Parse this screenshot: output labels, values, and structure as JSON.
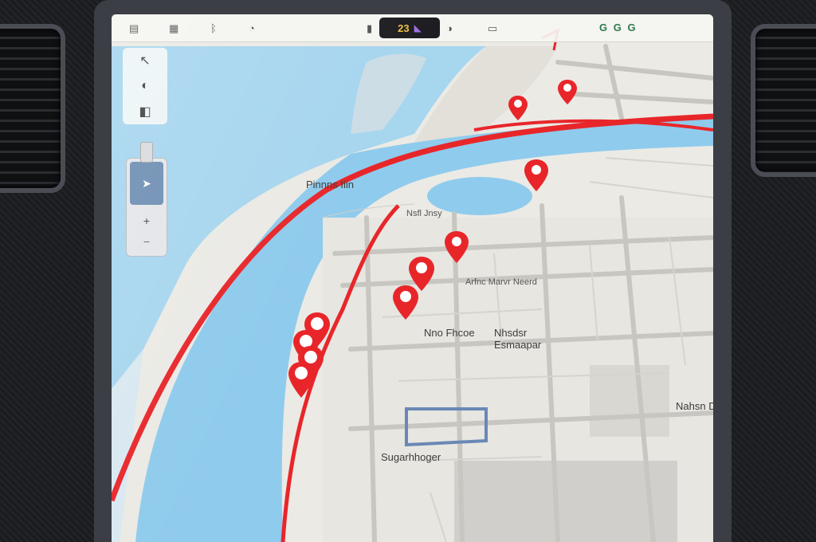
{
  "status_bar": {
    "left_icons": [
      "menu-icon",
      "grid-icon",
      "bluetooth-icon",
      "wifi-icon",
      "cellular-icon",
      "lock-icon"
    ],
    "temperature": "23",
    "temperature_icon": "wiper-icon",
    "right_text": "G G G"
  },
  "controls": {
    "top_buttons": [
      "compass-icon",
      "volume-icon",
      "layers-icon"
    ],
    "zoom_icon": "navigation-arrow-icon",
    "zoom_mid": "+",
    "zoom_bottom": "−"
  },
  "right_tab": {
    "items": [
      "‹",
      "›"
    ]
  },
  "map": {
    "labels": [
      "Pinnns Iiin",
      "Nsfl Jnsy",
      "Arfnc Marvr Neerd",
      "Nno Fhcoe",
      "Nhsdsr Esmaapar",
      "Nahsn Dem",
      "Sugarhhoger"
    ],
    "route_color": "#e8262a",
    "water_color": "#9fd3ee",
    "pin_color": "#e8262a"
  }
}
